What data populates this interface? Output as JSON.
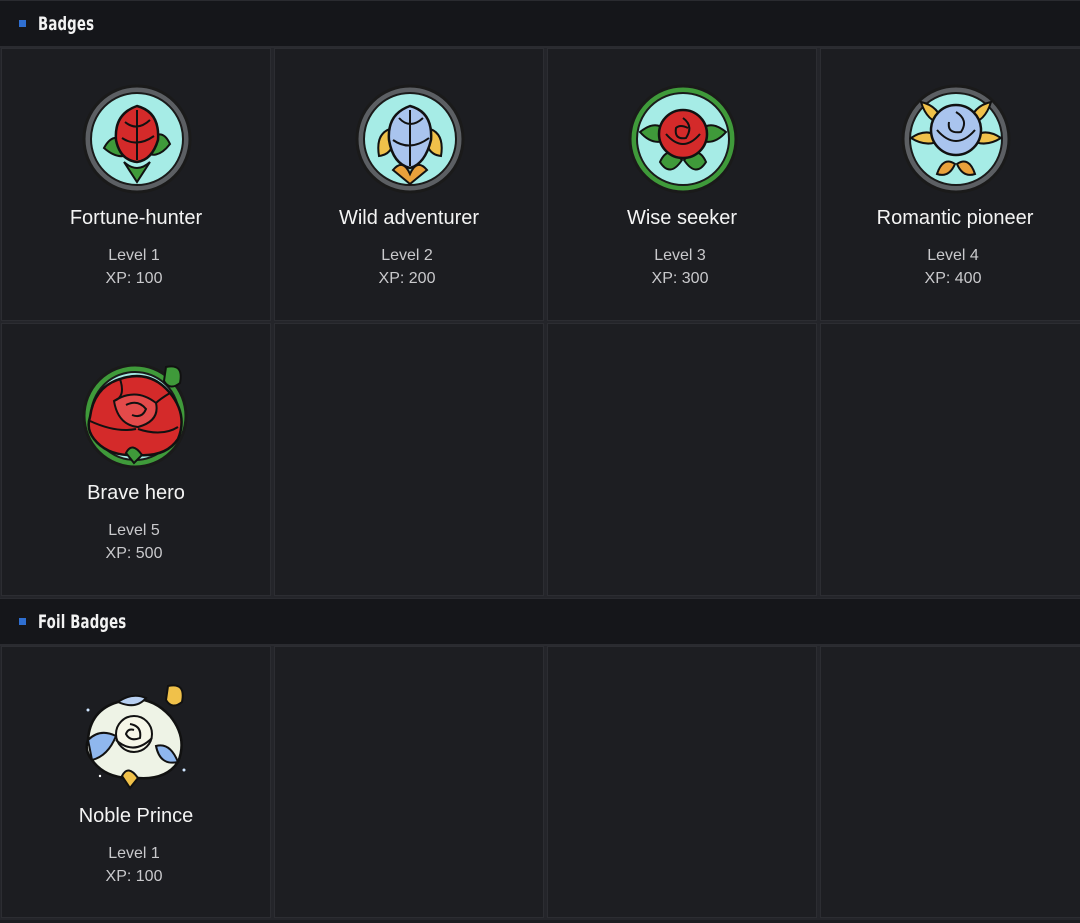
{
  "sections": [
    {
      "title": "Badges",
      "badges": [
        {
          "name": "Fortune-hunter",
          "level": "Level 1",
          "xp": "XP: 100",
          "icon": "red-rosebud-stained-glass-icon"
        },
        {
          "name": "Wild adventurer",
          "level": "Level 2",
          "xp": "XP: 200",
          "icon": "blue-rosebud-stained-glass-icon"
        },
        {
          "name": "Wise seeker",
          "level": "Level 3",
          "xp": "XP: 300",
          "icon": "red-rose-stained-glass-icon"
        },
        {
          "name": "Romantic pioneer",
          "level": "Level 4",
          "xp": "XP: 400",
          "icon": "blue-rose-stained-glass-icon"
        },
        {
          "name": "Brave hero",
          "level": "Level 5",
          "xp": "XP: 500",
          "icon": "red-rose-bloom-stained-glass-icon"
        }
      ]
    },
    {
      "title": "Foil Badges",
      "badges": [
        {
          "name": "Noble Prince",
          "level": "Level 1",
          "xp": "XP: 100",
          "icon": "white-rose-foil-icon"
        }
      ]
    }
  ],
  "colors": {
    "background": "#1b1c20",
    "header": "#15161a",
    "accent": "#2f6fd1",
    "red_rose": "#d42a2a",
    "blue_rose": "#9fbde8",
    "leaf": "#3f9a3a",
    "glass": "#9fe6e0"
  }
}
